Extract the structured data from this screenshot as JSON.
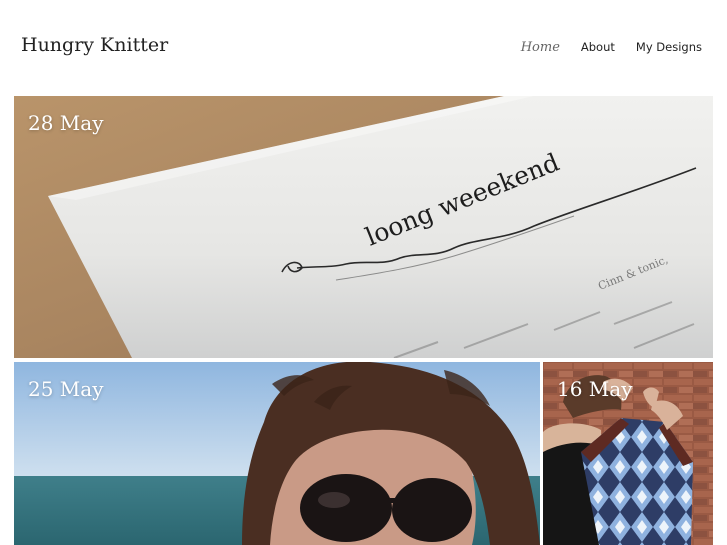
{
  "header": {
    "site_title": "Hungry Knitter",
    "nav": [
      {
        "label": "Home",
        "current": true
      },
      {
        "label": "About",
        "current": false
      },
      {
        "label": "My Designs",
        "current": false
      }
    ]
  },
  "posts": [
    {
      "date": "28 May",
      "image": {
        "handwriting": "loong weeekend",
        "fine_print": "Cinn & tonic,"
      }
    },
    {
      "date": "25 May"
    },
    {
      "date": "16 May"
    }
  ]
}
